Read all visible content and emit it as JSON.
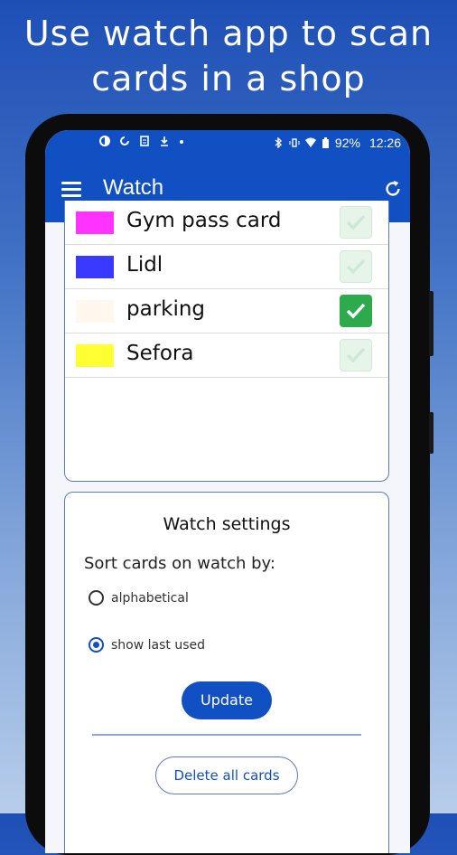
{
  "headline": {
    "line1": "Use watch app to scan",
    "line2": "cards in a shop"
  },
  "status_bar": {
    "battery": "92%",
    "time": "12:26"
  },
  "app_bar": {
    "title": "Watch"
  },
  "cards": [
    {
      "name": "Gym pass card",
      "color": "#ff33ff",
      "checked": false
    },
    {
      "name": "Lidl",
      "color": "#3a3aff",
      "checked": false
    },
    {
      "name": "parking",
      "color": "#fff8ee",
      "checked": true
    },
    {
      "name": "Sefora",
      "color": "#ffff33",
      "checked": false
    }
  ],
  "settings": {
    "title": "Watch settings",
    "sort_label": "Sort cards on watch by:",
    "options": [
      {
        "label": "alphabetical",
        "selected": false
      },
      {
        "label": "show last used",
        "selected": true
      }
    ],
    "update_label": "Update",
    "delete_label": "Delete all cards"
  },
  "colors": {
    "primary": "#1150c3",
    "check_green": "#2daa4c"
  }
}
